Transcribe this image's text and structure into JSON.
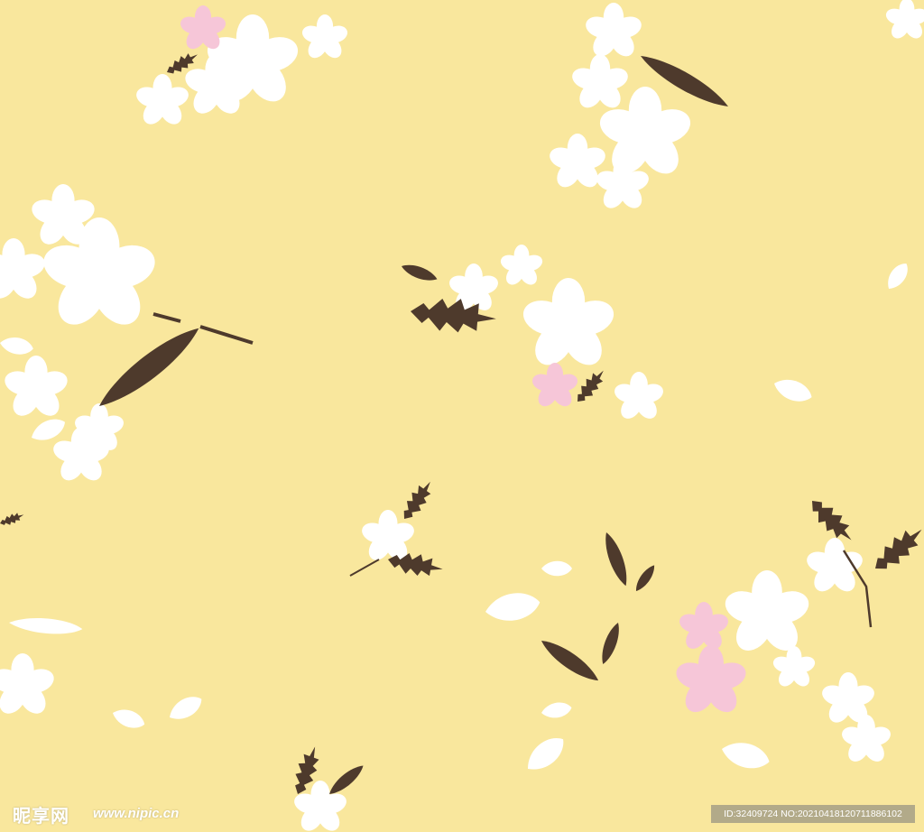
{
  "background_color": "#f9e79d",
  "palette": {
    "petal": "#ffffff",
    "blossom": "#f6c6d8",
    "leaf": "#4e3a2c",
    "center": "#6b7a4a"
  },
  "watermark": {
    "logo_text": "昵享网",
    "url_text": "www.nipic.cn",
    "id_text": "ID:32409724 NO:20210418120711886102"
  }
}
